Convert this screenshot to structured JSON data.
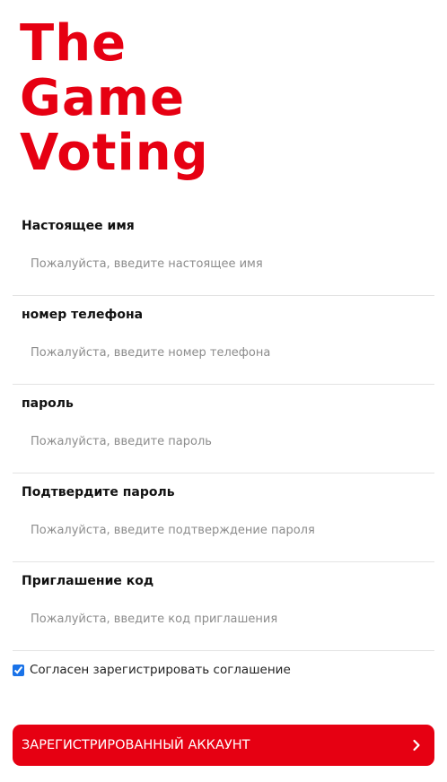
{
  "logo": {
    "line1": "The",
    "line2": "Game",
    "line3": "Voting"
  },
  "form": {
    "fields": [
      {
        "label": "Настоящее имя",
        "placeholder": "Пожалуйста, введите настоящее имя",
        "value": ""
      },
      {
        "label": "номер телефона",
        "placeholder": "Пожалуйста, введите номер телефона",
        "value": ""
      },
      {
        "label": "пароль",
        "placeholder": "Пожалуйста, введите пароль",
        "value": ""
      },
      {
        "label": "Подтвердите пароль",
        "placeholder": "Пожалуйста, введите подтверждение пароля",
        "value": ""
      },
      {
        "label": "Приглашение код",
        "placeholder": "Пожалуйста, введите код приглашения",
        "value": ""
      }
    ],
    "agreement": {
      "label": "Согласен зарегистрировать соглашение",
      "checked": true
    },
    "submit": {
      "label": "ЗАРЕГИСТРИРОВАННЫЙ АККАУНТ",
      "icon": "chevron-right-icon"
    }
  },
  "colors": {
    "brand_red": "#e60012",
    "checkbox_blue": "#1a73e8"
  }
}
